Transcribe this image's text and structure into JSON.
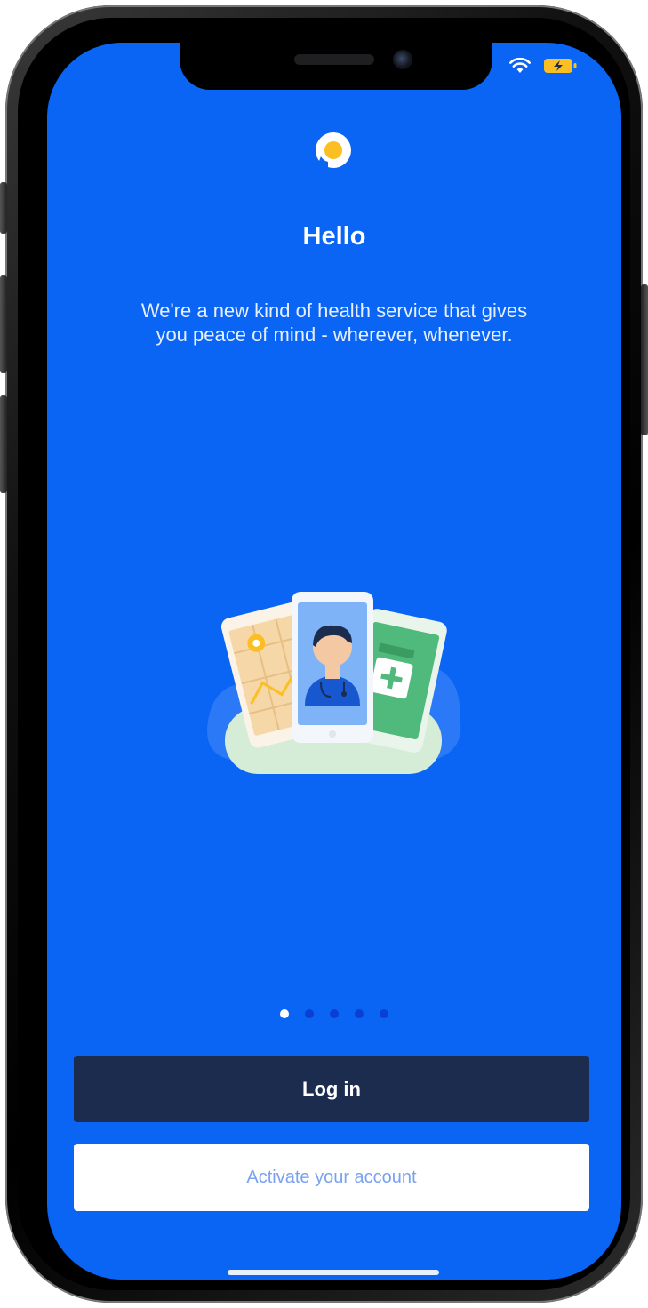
{
  "status_bar": {
    "wifi_icon": "wifi-icon",
    "battery_icon": "battery-charging-icon"
  },
  "app": {
    "logo_icon": "app-logo-icon"
  },
  "welcome": {
    "title": "Hello",
    "subtitle": "We're a new kind of health service that gives you peace of mind - wherever, whenever."
  },
  "illustration": {
    "icon": "health-cards-illustration"
  },
  "pagination": {
    "total": 5,
    "active": 1
  },
  "actions": {
    "login_label": "Log in",
    "activate_label": "Activate your account"
  },
  "colors": {
    "background": "#0a64f4",
    "primary_button": "#1b2c4f",
    "secondary_button": "#ffffff",
    "logo_accent": "#fbbf24"
  }
}
